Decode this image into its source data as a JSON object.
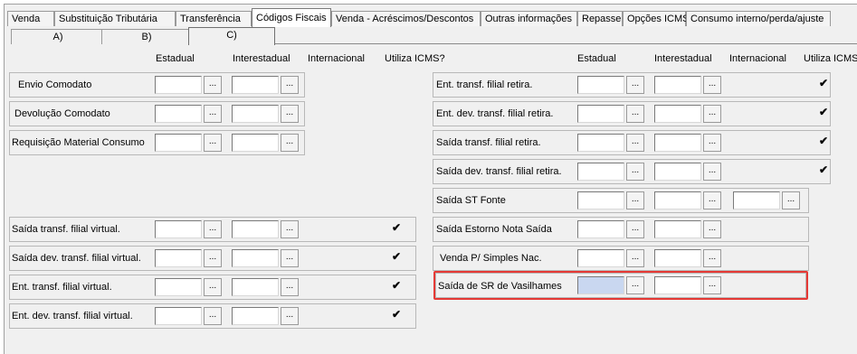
{
  "top_tabs": [
    "Venda",
    "Substituição Tributária",
    "Transferência",
    "Códigos Fiscais",
    "Venda - Acréscimos/Descontos",
    "Outras informações",
    "Repasse",
    "Opções ICMS",
    "Consumo interno/perda/ajuste"
  ],
  "sub_tabs": [
    "A)",
    "B)",
    "C)"
  ],
  "headers": {
    "left": [
      "Estadual",
      "Interestadual",
      "Internacional",
      "Utiliza ICMS?"
    ],
    "right": [
      "Estadual",
      "Interestadual",
      "Internacional",
      "Utiliza ICMS"
    ]
  },
  "button_label": "...",
  "check_mark": "✔",
  "left_rows": [
    {
      "label": "Envio Comodato"
    },
    {
      "label": "Devolução Comodato"
    },
    {
      "label": "Requisição Material Consumo"
    },
    {
      "label": "Saída transf. filial virtual.",
      "checked": true
    },
    {
      "label": "Saída dev. transf. filial virtual.",
      "checked": true
    },
    {
      "label": "Ent. transf. filial virtual.",
      "checked": true
    },
    {
      "label": "Ent. dev. transf. filial virtual.",
      "checked": true
    }
  ],
  "right_rows": [
    {
      "label": "Ent. transf. filial retira.",
      "checked": true
    },
    {
      "label": "Ent. dev. transf. filial retira.",
      "checked": true
    },
    {
      "label": "Saída transf. filial retira.",
      "checked": true
    },
    {
      "label": "Saída dev. transf. filial retira.",
      "checked": true
    },
    {
      "label": "Saída ST Fonte"
    },
    {
      "label": "Saída Estorno Nota Saída"
    },
    {
      "label": "Venda P/ Simples Nac."
    },
    {
      "label": "Saída de SR de Vasilhames"
    }
  ],
  "colors": {
    "highlight": "#e53935",
    "focused_input": "#c9d7f0"
  }
}
